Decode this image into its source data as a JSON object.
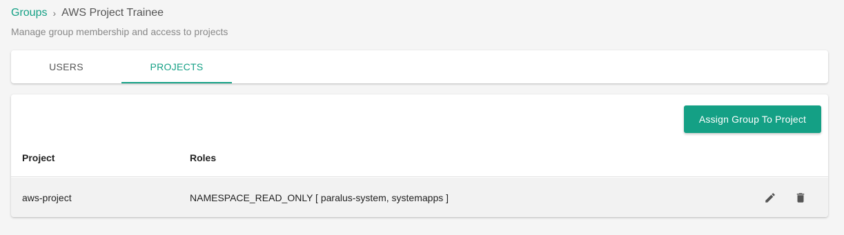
{
  "breadcrumb": {
    "parent": "Groups",
    "separator": "›",
    "current": "AWS Project Trainee"
  },
  "subtitle": "Manage group membership and access to projects",
  "tabs": [
    {
      "label": "USERS",
      "active": false
    },
    {
      "label": "PROJECTS",
      "active": true
    }
  ],
  "toolbar": {
    "assign_label": "Assign Group To Project"
  },
  "table": {
    "columns": [
      "Project",
      "Roles"
    ],
    "rows": [
      {
        "project": "aws-project",
        "roles": "NAMESPACE_READ_ONLY [ paralus-system, systemapps ]",
        "actions": [
          "pencil-icon",
          "trash-icon"
        ]
      }
    ]
  },
  "colors": {
    "accent": "#14a085",
    "background": "#f5f5f5",
    "row_bg": "#f2f2f2"
  }
}
